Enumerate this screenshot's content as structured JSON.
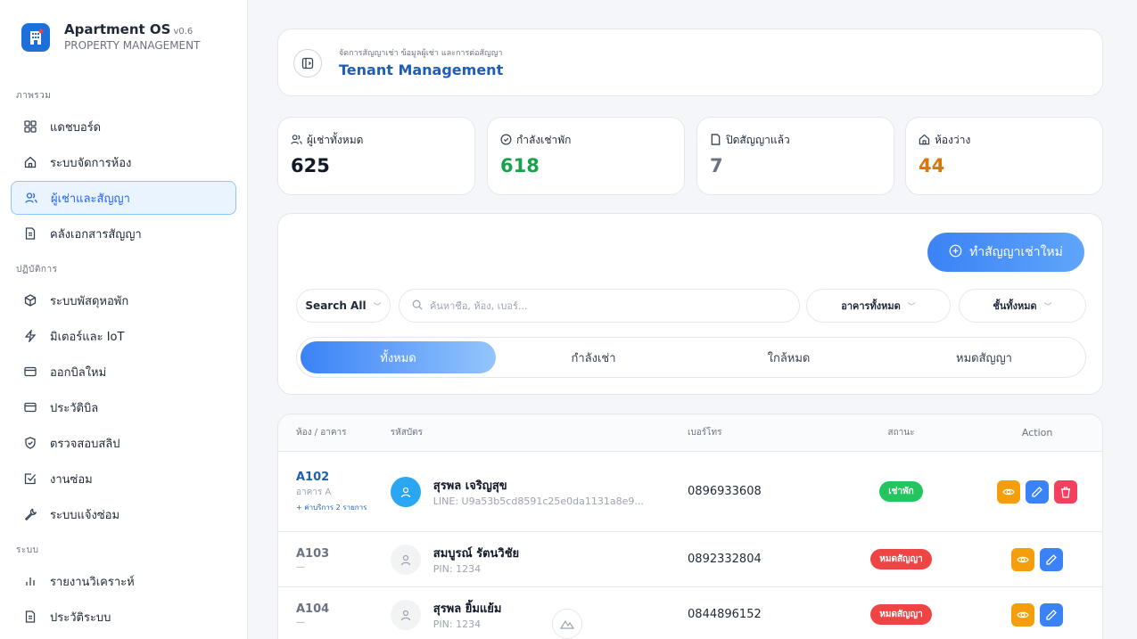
{
  "brand": {
    "title": "Apartment OS",
    "version": "v0.6",
    "subtitle": "PROPERTY MANAGEMENT"
  },
  "sidebar": {
    "sections": [
      {
        "label": "ภาพรวม",
        "items": [
          {
            "label": "แดชบอร์ด",
            "icon": "grid-icon"
          },
          {
            "label": "ระบบจัดการห้อง",
            "icon": "home-icon"
          },
          {
            "label": "ผู้เช่าและสัญญา",
            "icon": "users-icon",
            "active": true
          },
          {
            "label": "คลังเอกสารสัญญา",
            "icon": "document-icon"
          }
        ]
      },
      {
        "label": "ปฏิบัติการ",
        "items": [
          {
            "label": "ระบบพัสดุหอพัก",
            "icon": "package-icon"
          },
          {
            "label": "มิเตอร์และ IoT",
            "icon": "bolt-icon"
          },
          {
            "label": "ออกบิลใหม่",
            "icon": "card-icon"
          },
          {
            "label": "ประวัติบิล",
            "icon": "card-icon"
          },
          {
            "label": "ตรวจสอบสลิป",
            "icon": "shield-check-icon"
          },
          {
            "label": "งานซ่อม",
            "icon": "checkbox-icon"
          },
          {
            "label": "ระบบแจ้งซ่อม",
            "icon": "wrench-icon"
          }
        ]
      },
      {
        "label": "ระบบ",
        "items": [
          {
            "label": "รายงานวิเคราะห์",
            "icon": "bar-chart-icon"
          },
          {
            "label": "ประวัติระบบ",
            "icon": "document-icon"
          }
        ]
      }
    ]
  },
  "header": {
    "subtitle": "จัดการสัญญาเช่า ข้อมูลผู้เช่า และการต่อสัญญา",
    "title": "Tenant Management"
  },
  "stats": [
    {
      "label": "ผู้เช่าทั้งหมด",
      "value": "625",
      "color": "#111827",
      "icon": "users-icon"
    },
    {
      "label": "กำลังเช่าพัก",
      "value": "618",
      "color": "#16a34a",
      "icon": "check-circle-icon"
    },
    {
      "label": "ปิดสัญญาแล้ว",
      "value": "7",
      "color": "#6b7280",
      "icon": "file-icon"
    },
    {
      "label": "ห้องว่าง",
      "value": "44",
      "color": "#d97706",
      "icon": "home-icon"
    }
  ],
  "filters": {
    "new_contract": "ทำสัญญาเช่าใหม่",
    "search_scope": "Search All",
    "search_placeholder": "ค้นหาชื่อ, ห้อง, เบอร์...",
    "building": "อาคารทั้งหมด",
    "floor": "ชั้นทั้งหมด",
    "tabs": [
      "ทั้งหมด",
      "กำลังเช่า",
      "ใกล้หมด",
      "หมดสัญญา"
    ]
  },
  "table": {
    "headers": [
      "ห้อง / อาคาร",
      "รหัสบัตร",
      "เบอร์โทร",
      "สถานะ",
      "Action"
    ],
    "rows": [
      {
        "room": "A102",
        "building": "อาคาร A",
        "extra": "+ ค่าบริการ 2 รายการ",
        "name": "สุรพล เจริญสุข",
        "id": "LINE: U9a53b5cd8591c25e0da1131a8e9...",
        "phone": "0896933608",
        "status": "เช่าพัก"
      },
      {
        "room": "A103",
        "building": "—",
        "extra": "",
        "name": "สมบูรณ์ รัตนวิชัย",
        "id": "PIN: 1234",
        "phone": "0892332804",
        "status": "หมดสัญญา"
      },
      {
        "room": "A104",
        "building": "—",
        "extra": "",
        "name": "สุรพล ยิ้มแย้ม",
        "id": "PIN: 1234",
        "phone": "0844896152",
        "status": "หมดสัญญา"
      }
    ]
  }
}
